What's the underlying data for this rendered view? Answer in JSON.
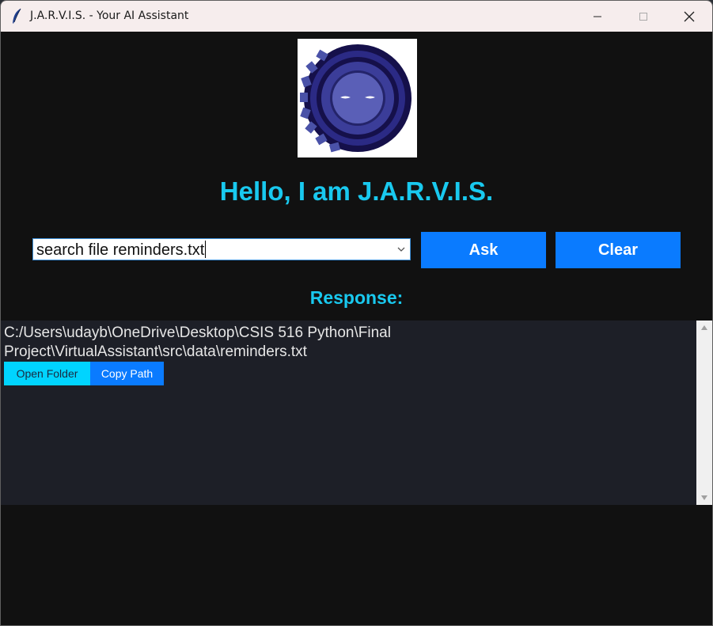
{
  "window": {
    "title": "J.A.R.V.I.S. - Your AI Assistant",
    "icons": {
      "app": "feather-icon",
      "minimize": "minimize-icon",
      "maximize": "maximize-icon",
      "close": "close-icon"
    }
  },
  "header": {
    "logo": "jarvis-logo",
    "greeting": "Hello, I am J.A.R.V.I.S."
  },
  "query": {
    "value": "search file reminders.txt",
    "dropdown_icon": "chevron-down-icon"
  },
  "actions": {
    "ask_label": "Ask",
    "clear_label": "Clear"
  },
  "response": {
    "label": "Response:",
    "line1": "C:/Users\\udayb\\OneDrive\\Desktop\\CSIS 516 Python\\Final",
    "line2": "Project\\VirtualAssistant\\src\\data\\reminders.txt",
    "open_folder_label": "Open Folder",
    "copy_path_label": "Copy Path"
  },
  "colors": {
    "background": "#111111",
    "accent_text": "#19c9ef",
    "button_blue": "#0a7bff",
    "button_cyan": "#00d4ff",
    "response_bg": "#1d1f27"
  }
}
